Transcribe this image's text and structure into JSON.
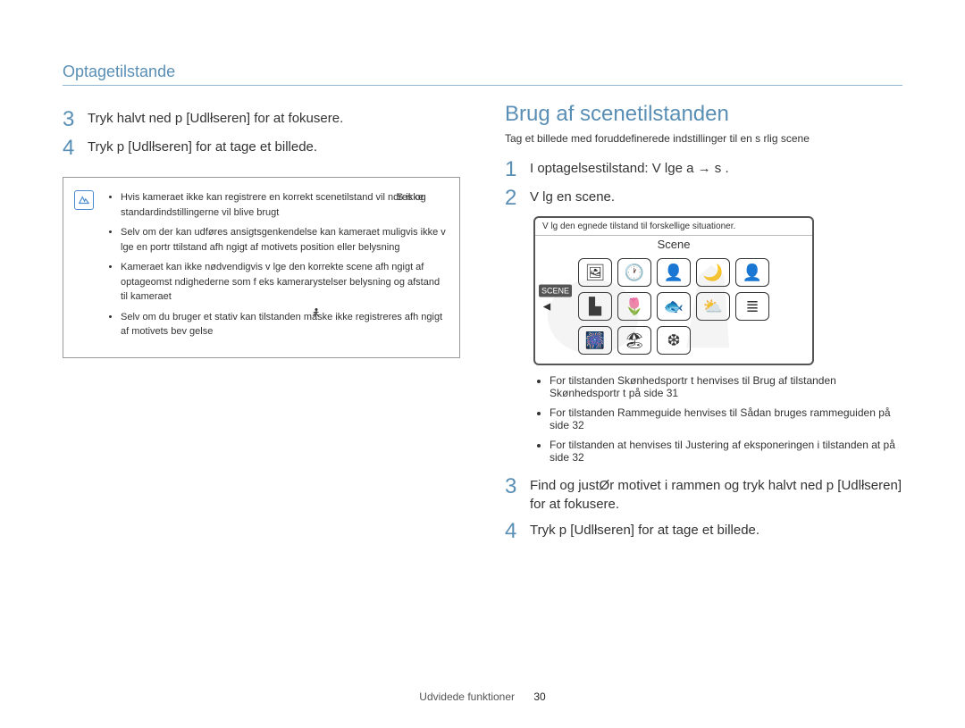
{
  "header": {
    "title": "Optagetilstande"
  },
  "left": {
    "step3": {
      "num": "3",
      "text": "Tryk halvt ned p [Udlłseren] for at fokusere."
    },
    "step4": {
      "num": "4",
      "text": "Tryk p [Udlłseren] for at tage et billede."
    },
    "note": {
      "s_label": "S    ikke",
      "items": [
        "Hvis kameraet ikke kan registrere en korrekt scenetilstand  vil           ndres og standardindstillingerne vil blive brugt",
        "Selv om der kan udføres ansigtsgenkendelse  kan kameraet muligvis ikke v lge en portr ttilstand afh ngigt af motivets position eller belysning",
        "Kameraet kan ikke nødvendigvis v lge den korrekte scene afh ngigt af optageomst ndighederne  som f eks  kamerarystelser  belysning og afstand til kameraet",
        "Selv om du bruger et stativ  kan tilstanden            måske ikke registreres afh ngigt af motivets bev gelse"
      ]
    }
  },
  "right": {
    "title": "Brug af scenetilstanden",
    "subtitle": "Tag et billede med foruddefinerede indstillinger til en s rlig scene",
    "step1": {
      "num": "1",
      "text": "I optagelsestilstand: V lge  a     →  s    ."
    },
    "step2": {
      "num": "2",
      "text": "V lg en scene."
    },
    "scene": {
      "header": "V lg den egnede tilstand til forskellige situationer.",
      "label": "Scene"
    },
    "bullets": [
      "For tilstanden     Skønhedsportr t henvises til  Brug af tilstanden Skønhedsportr t  på side 31",
      "For tilstanden     Rammeguide henvises til  Sådan bruges rammeguiden  på side 32",
      "For tilstanden      at henvises til  Justering af eksponeringen i tilstanden  at  på side 32"
    ],
    "step3": {
      "num": "3",
      "text": "Find og justØr motivet i rammen og tryk halvt ned p [Udlłseren] for at fokusere."
    },
    "step4": {
      "num": "4",
      "text": "Tryk p [Udlłseren] for at tage et billede."
    }
  },
  "scene_icons": [
    "🖼",
    "🕐",
    "👤",
    "🌙",
    "👤",
    "▙",
    "🌷",
    "🐟",
    "⛅",
    "≣",
    "🎆",
    "🏖",
    "❆",
    ""
  ],
  "footer": {
    "section": "Udvidede funktioner",
    "page": "30"
  }
}
